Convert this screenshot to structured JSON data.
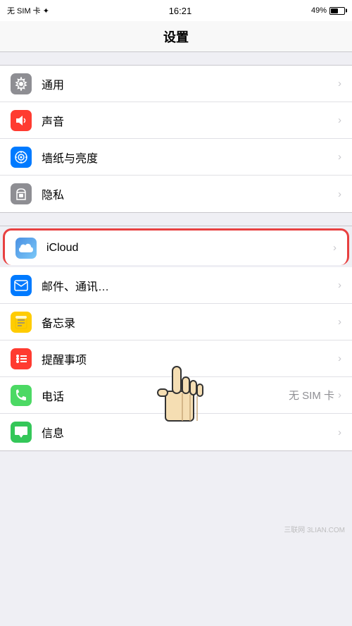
{
  "statusBar": {
    "left": "无 SIM 卡 ✦",
    "time": "16:21",
    "battery": "49%"
  },
  "pageTitle": "设置",
  "groups": [
    {
      "id": "group1",
      "items": [
        {
          "id": "general",
          "label": "通用",
          "iconColor": "icon-gray",
          "iconSymbol": "⚙"
        },
        {
          "id": "sound",
          "label": "声音",
          "iconColor": "icon-red",
          "iconSymbol": "🔊"
        },
        {
          "id": "wallpaper",
          "label": "墙纸与亮度",
          "iconColor": "icon-blue",
          "iconSymbol": "✿"
        },
        {
          "id": "privacy",
          "label": "隐私",
          "iconColor": "icon-gray",
          "iconSymbol": "✋"
        }
      ]
    },
    {
      "id": "group2",
      "items": [
        {
          "id": "icloud",
          "label": "iCloud",
          "iconColor": "icon-blue",
          "iconSymbol": "☁",
          "highlighted": true
        },
        {
          "id": "mail",
          "label": "邮件、通讯…",
          "iconColor": "icon-blue",
          "iconSymbol": "✉"
        },
        {
          "id": "notes",
          "label": "备忘录",
          "iconColor": "icon-yellow",
          "iconSymbol": "📝"
        },
        {
          "id": "reminders",
          "label": "提醒事项",
          "iconColor": "icon-red",
          "iconSymbol": "≡"
        },
        {
          "id": "phone",
          "label": "电话",
          "value": "无 SIM 卡",
          "iconColor": "icon-green",
          "iconSymbol": "📞"
        },
        {
          "id": "messages",
          "label": "信息",
          "iconColor": "icon-green2",
          "iconSymbol": "💬"
        }
      ]
    }
  ],
  "watermark": "三联网 3LIAN.COM"
}
